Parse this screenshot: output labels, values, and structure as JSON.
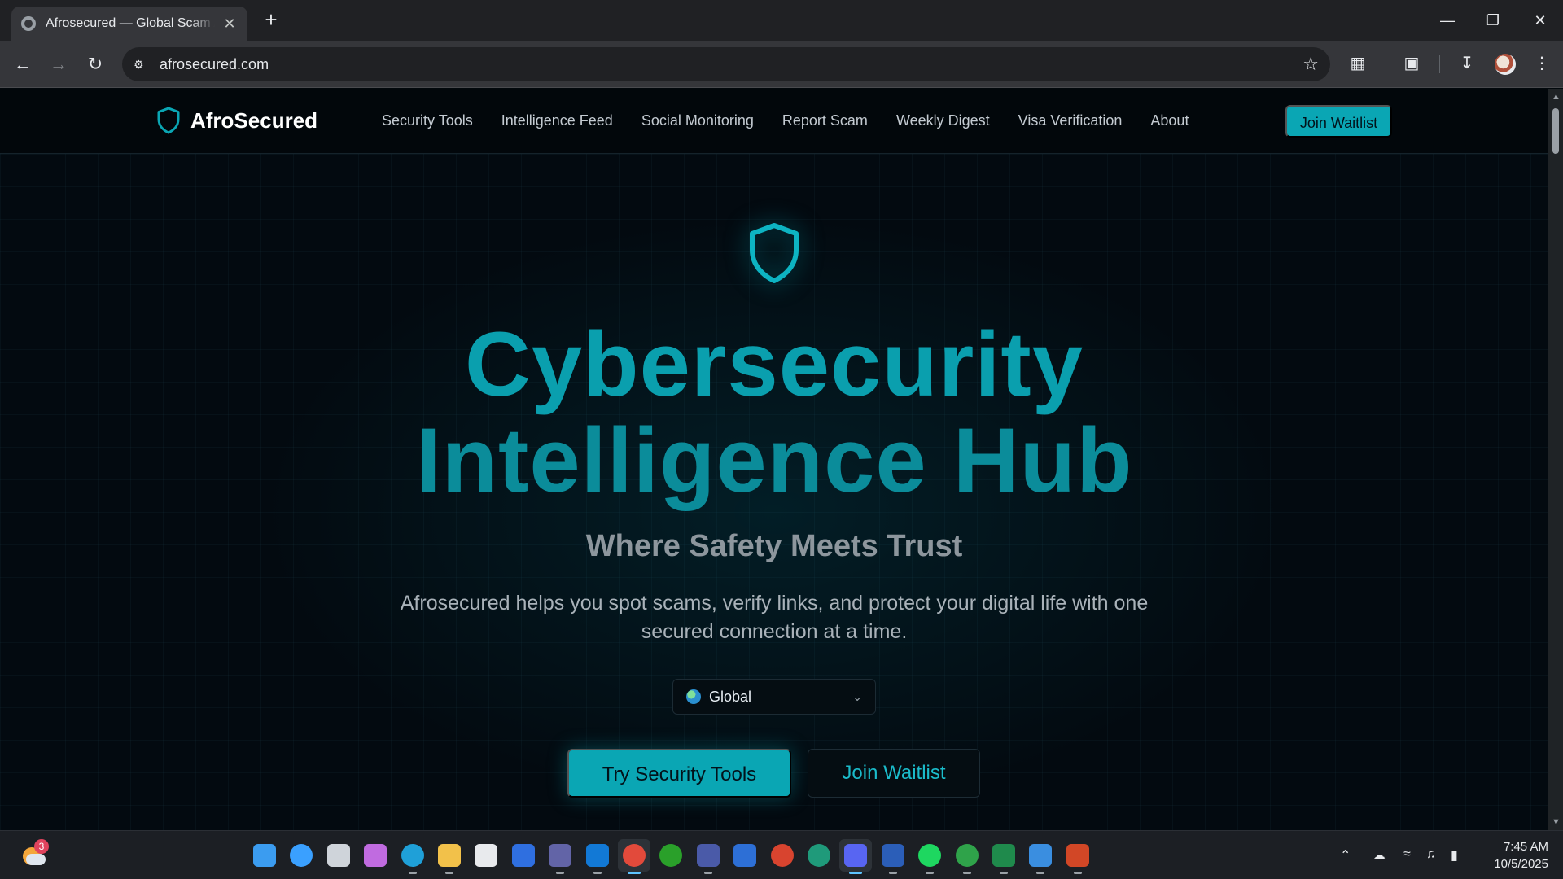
{
  "browser": {
    "tab_title": "Afrosecured — Global Scam Awareness",
    "url": "afrosecured.com",
    "new_tab_label": "+",
    "close_tab_label": "✕"
  },
  "site": {
    "logo_text": "AfroSecured",
    "nav": [
      {
        "label": "Security Tools"
      },
      {
        "label": "Intelligence Feed"
      },
      {
        "label": "Social Monitoring"
      },
      {
        "label": "Report Scam"
      },
      {
        "label": "Weekly Digest"
      },
      {
        "label": "Visa Verification"
      },
      {
        "label": "About"
      }
    ],
    "nav_cta": "Join Waitlist",
    "accent_color": "#0aa6b4"
  },
  "hero": {
    "headline_line1": "Cybersecurity",
    "headline_line2": "Intelligence Hub",
    "tagline": "Where Safety Meets Trust",
    "lead": "Afrosecured helps you spot scams, verify links, and protect your digital life with one secured connection at a time.",
    "region_selected": "Global",
    "primary_button": "Try Security Tools",
    "secondary_button": "Join Waitlist"
  },
  "taskbar": {
    "weather_badge": "3",
    "apps": [
      {
        "name": "start",
        "color": "#3b9cf0"
      },
      {
        "name": "search",
        "color": "#3aa0ff"
      },
      {
        "name": "task-view",
        "color": "#cfd4da"
      },
      {
        "name": "copilot",
        "color": "#c06be0"
      },
      {
        "name": "edge",
        "color": "#1fa0d8"
      },
      {
        "name": "file-explorer",
        "color": "#f2c14a"
      },
      {
        "name": "store",
        "color": "#e8eaed"
      },
      {
        "name": "app-blue",
        "color": "#2f6fe0"
      },
      {
        "name": "teams",
        "color": "#6264a7"
      },
      {
        "name": "outlook",
        "color": "#1279d6"
      },
      {
        "name": "chrome",
        "color": "#e24a3b"
      },
      {
        "name": "xbox",
        "color": "#2aa02a"
      },
      {
        "name": "app-stripes",
        "color": "#4a5aa8"
      },
      {
        "name": "app-arc",
        "color": "#2d6fd6"
      },
      {
        "name": "app-red",
        "color": "#d8442f"
      },
      {
        "name": "app-green-ring",
        "color": "#1f9a7a"
      },
      {
        "name": "discord",
        "color": "#5865f2"
      },
      {
        "name": "word",
        "color": "#2b5eb8"
      },
      {
        "name": "spotify",
        "color": "#1ed760"
      },
      {
        "name": "app-green-circle",
        "color": "#2fa34a"
      },
      {
        "name": "excel",
        "color": "#1f8a4c"
      },
      {
        "name": "photos",
        "color": "#3a8ee0"
      },
      {
        "name": "powerpoint",
        "color": "#d24726"
      }
    ],
    "time": "7:45 AM",
    "date": "10/5/2025"
  }
}
